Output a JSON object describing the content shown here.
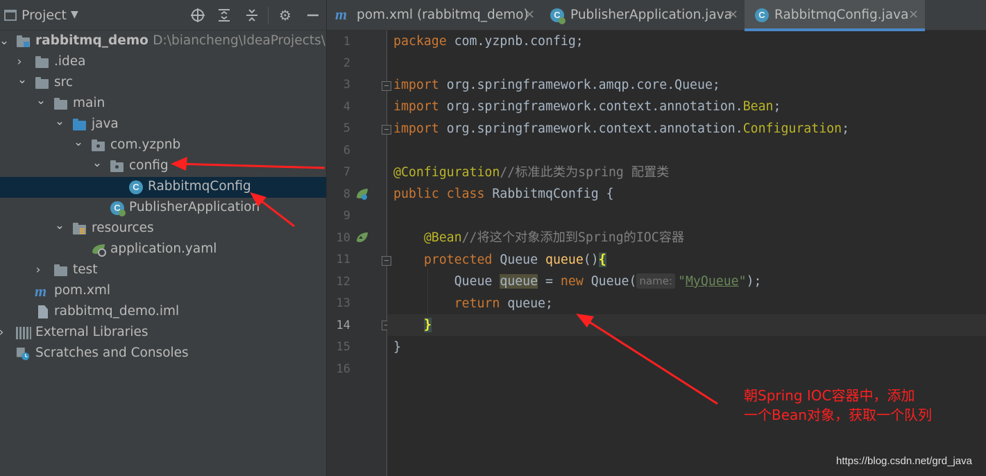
{
  "project_panel": {
    "title": "Project",
    "tree": [
      {
        "label": "rabbitmq_demo",
        "path": "D:\\biancheng\\IdeaProjects\\rab",
        "icon": "module-folder-icon"
      },
      {
        "label": ".idea",
        "icon": "folder-icon"
      },
      {
        "label": "src",
        "icon": "folder-icon"
      },
      {
        "label": "main",
        "icon": "folder-icon"
      },
      {
        "label": "java",
        "icon": "source-folder-icon"
      },
      {
        "label": "com.yzpnb",
        "icon": "package-icon"
      },
      {
        "label": "config",
        "icon": "package-icon"
      },
      {
        "label": "RabbitmqConfig",
        "icon": "java-class-icon",
        "selected": true
      },
      {
        "label": "PublisherApplication",
        "icon": "spring-boot-class-icon"
      },
      {
        "label": "resources",
        "icon": "resources-folder-icon"
      },
      {
        "label": "application.yaml",
        "icon": "spring-config-icon"
      },
      {
        "label": "test",
        "icon": "folder-icon"
      },
      {
        "label": "pom.xml",
        "icon": "maven-icon"
      },
      {
        "label": "rabbitmq_demo.iml",
        "icon": "iml-file-icon"
      },
      {
        "label": "External Libraries",
        "icon": "libraries-icon"
      },
      {
        "label": "Scratches and Consoles",
        "icon": "scratches-icon"
      }
    ]
  },
  "tabs": [
    {
      "label": "pom.xml (rabbitmq_demo)",
      "close": "×",
      "icon": "maven-icon"
    },
    {
      "label": "PublisherApplication.java",
      "close": "×",
      "icon": "spring-boot-class-icon"
    },
    {
      "label": "RabbitmqConfig.java",
      "close": "×",
      "icon": "java-class-icon",
      "active": true
    }
  ],
  "editor": {
    "line_numbers": [
      "1",
      "2",
      "3",
      "4",
      "5",
      "6",
      "7",
      "8",
      "9",
      "10",
      "11",
      "12",
      "13",
      "14",
      "15",
      "16"
    ],
    "current_line": "14",
    "code": {
      "l1_kw": "package",
      "l1_rest": " com.yzpnb.config;",
      "l3_kw": "import",
      "l3_rest": " org.springframework.amqp.core.Queue;",
      "l4_kw": "import",
      "l4_mid": " org.springframework.context.annotation.",
      "l4_cls": "Bean",
      "l4_end": ";",
      "l5_kw": "import",
      "l5_mid": " org.springframework.context.annotation.",
      "l5_cls": "Configuration",
      "l5_end": ";",
      "l7_ann": "@Configuration",
      "l7_cmt": "//标准此类为spring 配置类",
      "l8_kw": "public class",
      "l8_rest": " RabbitmqConfig {",
      "l10_ann": "@Bean",
      "l10_cmt": "//将这个对象添加到Spring的IOC容器",
      "l11_kw": "protected",
      "l11_type": " Queue ",
      "l11_fn": "queue",
      "l11_paren": "()",
      "l11_brace": "{",
      "l12_type": "Queue ",
      "l12_var": "queue",
      "l12_eq": " = ",
      "l12_kw": "new",
      "l12_call": " Queue(",
      "l12_hint": "name:",
      "l12_q1": "\"",
      "l12_str": "MyQueue",
      "l12_q2": "\"",
      "l12_end": ");",
      "l13_kw": "return",
      "l13_rest": " queue;",
      "l14_brace": "}",
      "l15": "}"
    }
  },
  "annotation": {
    "line1": "朝Spring IOC容器中，添加",
    "line2": "一个Bean对象，获取一个队列",
    "color": "#ff2020"
  },
  "watermark": "https://blog.csdn.net/grd_java",
  "colors": {
    "keyword": "#cc7832",
    "annotation": "#bbb529",
    "comment": "#808080",
    "method": "#ffc66d",
    "string": "#6a8759",
    "selection": "#0d293e",
    "accent": "#4a88c7"
  }
}
